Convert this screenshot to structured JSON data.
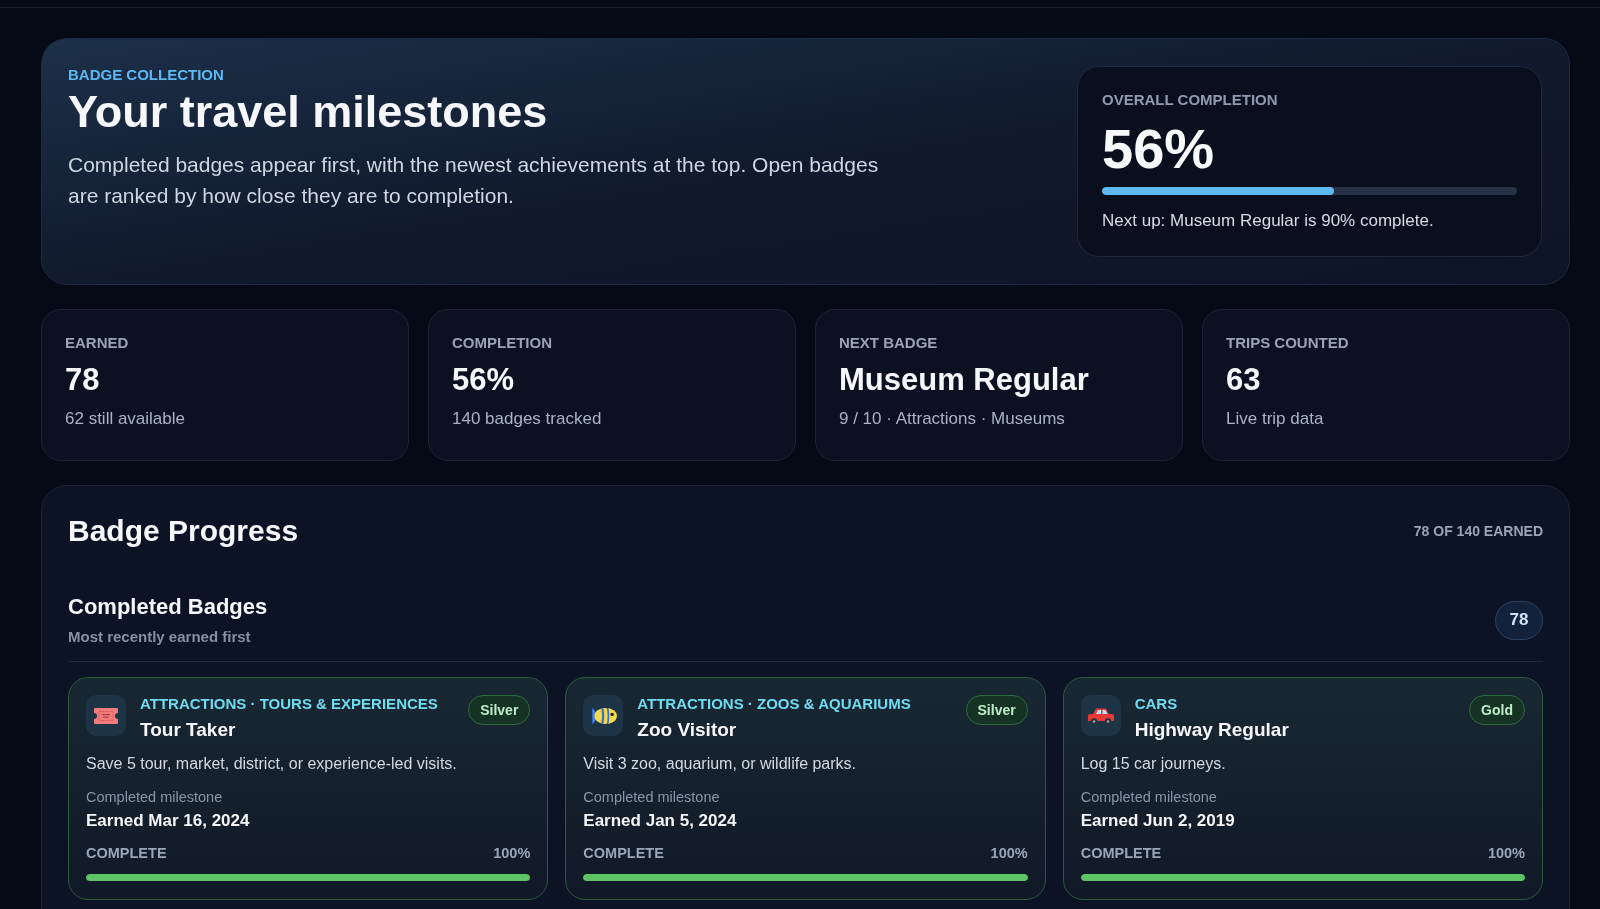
{
  "header": {
    "eyebrow": "BADGE COLLECTION",
    "title": "Your travel milestones",
    "description": "Completed badges appear first, with the newest achievements at the top. Open badges are ranked by how close they are to completion.",
    "overall": {
      "label": "OVERALL COMPLETION",
      "value": "56%",
      "level": 0.56,
      "note": "Next up: Museum Regular is 90% complete."
    }
  },
  "stats": [
    {
      "label": "EARNED",
      "value": "78",
      "note": "62 still available"
    },
    {
      "label": "COMPLETION",
      "value": "56%",
      "note": "140 badges tracked"
    },
    {
      "label": "NEXT BADGE",
      "value": "Museum Regular",
      "note": "9 / 10 · Attractions · Museums"
    },
    {
      "label": "TRIPS COUNTED",
      "value": "63",
      "note": "Live trip data"
    }
  ],
  "progress": {
    "title": "Badge Progress",
    "summary": "78 OF 140 EARNED",
    "section": {
      "title": "Completed Badges",
      "subtitle": "Most recently earned first",
      "count": "78",
      "badges": [
        {
          "category": "ATTRACTIONS · TOURS & EXPERIENCES",
          "name": "Tour Taker",
          "tier": "Silver",
          "description": "Save 5 tour, market, district, or experience-led visits.",
          "milestone_label": "Completed milestone",
          "earned": "Earned Mar 16, 2024",
          "status": "COMPLETE",
          "percent": "100%",
          "level": 1
        },
        {
          "category": "ATTRACTIONS · ZOOS & AQUARIUMS",
          "name": "Zoo Visitor",
          "tier": "Silver",
          "description": "Visit 3 zoo, aquarium, or wildlife parks.",
          "milestone_label": "Completed milestone",
          "earned": "Earned Jan 5, 2024",
          "status": "COMPLETE",
          "percent": "100%",
          "level": 1
        },
        {
          "category": "CARS",
          "name": "Highway Regular",
          "tier": "Gold",
          "description": "Log 15 car journeys.",
          "milestone_label": "Completed milestone",
          "earned": "Earned Jun 2, 2019",
          "status": "COMPLETE",
          "percent": "100%",
          "level": 1
        }
      ]
    }
  }
}
